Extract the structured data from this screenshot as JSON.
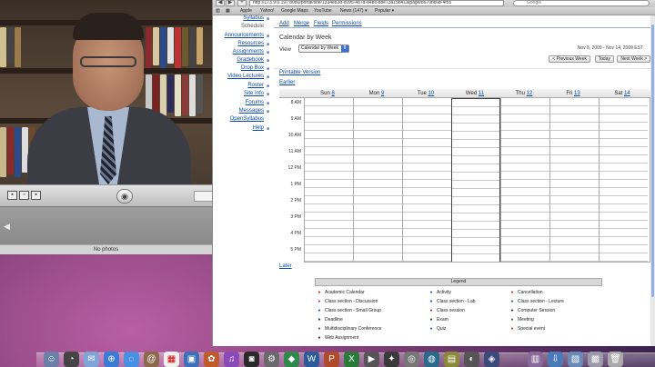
{
  "browser": {
    "url": "http://173.9.0.197:8080/portal/site/1334e83d-c095-487d-84bc-88e73a15b41a/page/8670bc6b-4f55",
    "search_placeholder": "Google",
    "bookmarks": [
      "Apple",
      "Yahoo!",
      "Google Maps",
      "YouTube",
      "News (147) ▾",
      "Popular ▾"
    ]
  },
  "sidebar": {
    "items": [
      {
        "label": "Syllabus",
        "link": true,
        "icon": "book-icon"
      },
      {
        "label": "Schedule",
        "link": false,
        "icon": ""
      },
      {
        "label": "Announcements",
        "link": true,
        "icon": "megaphone-icon"
      },
      {
        "label": "Resources",
        "link": true,
        "icon": "folder-icon"
      },
      {
        "label": "Assignments",
        "link": true,
        "icon": "pencil-icon"
      },
      {
        "label": "Gradebook",
        "link": true,
        "icon": "gradebook-icon"
      },
      {
        "label": "Drop Box",
        "link": true,
        "icon": "dropbox-icon"
      },
      {
        "label": "Video Lectures",
        "link": true,
        "icon": "video-icon"
      },
      {
        "label": "Roster",
        "link": true,
        "icon": "roster-icon"
      },
      {
        "label": "Site Info",
        "link": true,
        "icon": "info-icon"
      },
      {
        "label": "Forums",
        "link": true,
        "icon": "forum-icon"
      },
      {
        "label": "Messages",
        "link": true,
        "icon": "mail-icon"
      },
      {
        "label": "OpenSyllabus",
        "link": true,
        "icon": ""
      },
      {
        "label": "Help",
        "link": true,
        "icon": "help-icon"
      }
    ]
  },
  "toolbar": {
    "add": "Add",
    "merge": "Merge",
    "fields": "Fields",
    "permissions": "Permissions"
  },
  "calendar": {
    "title": "Calendar by Week",
    "view_label": "View",
    "view_value": "Calendar by Week",
    "date_range": "Nov 8, 2009 - Nov 14, 2009 EST",
    "prev_week": "< Previous Week",
    "today": "Today",
    "next_week": "Next Week >",
    "printable": "Printable Version",
    "earlier": "Earlier",
    "later": "Later",
    "days": [
      {
        "name": "Sun",
        "num": "8"
      },
      {
        "name": "Mon",
        "num": "9"
      },
      {
        "name": "Tue",
        "num": "10"
      },
      {
        "name": "Wed",
        "num": "11"
      },
      {
        "name": "Thu",
        "num": "12"
      },
      {
        "name": "Fri",
        "num": "13"
      },
      {
        "name": "Sat",
        "num": "14"
      }
    ],
    "hours": [
      "8 AM",
      "9 AM",
      "10 AM",
      "11 AM",
      "12 PM",
      "1 PM",
      "2 PM",
      "3 PM",
      "4 PM",
      "5 PM"
    ]
  },
  "legend": {
    "title": "Legend",
    "items": [
      {
        "label": "Academic Calendar",
        "icon": "calendar-icon",
        "color": "#c0392b"
      },
      {
        "label": "Activity",
        "icon": "activity-icon",
        "color": "#2c5aa0"
      },
      {
        "label": "Cancellation",
        "icon": "cancel-icon",
        "color": "#c0392b"
      },
      {
        "label": "Class section - Discussion",
        "icon": "discussion-icon",
        "color": "#8e44ad"
      },
      {
        "label": "Class section - Lab",
        "icon": "lab-icon",
        "color": "#2c5aa0"
      },
      {
        "label": "Class section - Lecture",
        "icon": "lecture-icon",
        "color": "#555555"
      },
      {
        "label": "Class section - Small Group",
        "icon": "group-icon",
        "color": "#2c5aa0"
      },
      {
        "label": "Class session",
        "icon": "session-icon",
        "color": "#c0392b"
      },
      {
        "label": "Computer Session",
        "icon": "computer-icon",
        "color": "#333333"
      },
      {
        "label": "Deadline",
        "icon": "deadline-icon",
        "color": "#333333"
      },
      {
        "label": "Exam",
        "icon": "exam-icon",
        "color": "#333333"
      },
      {
        "label": "Meeting",
        "icon": "meeting-icon",
        "color": "#555555"
      },
      {
        "label": "Multidisciplinary Conference",
        "icon": "conference-icon",
        "color": "#555555"
      },
      {
        "label": "Quiz",
        "icon": "quiz-icon",
        "color": "#2c5aa0"
      },
      {
        "label": "Special event",
        "icon": "star-icon",
        "color": "#c0392b"
      },
      {
        "label": "Web Assignment",
        "icon": "web-icon",
        "color": "#333333"
      }
    ]
  },
  "photobooth": {
    "status": "No photos"
  }
}
